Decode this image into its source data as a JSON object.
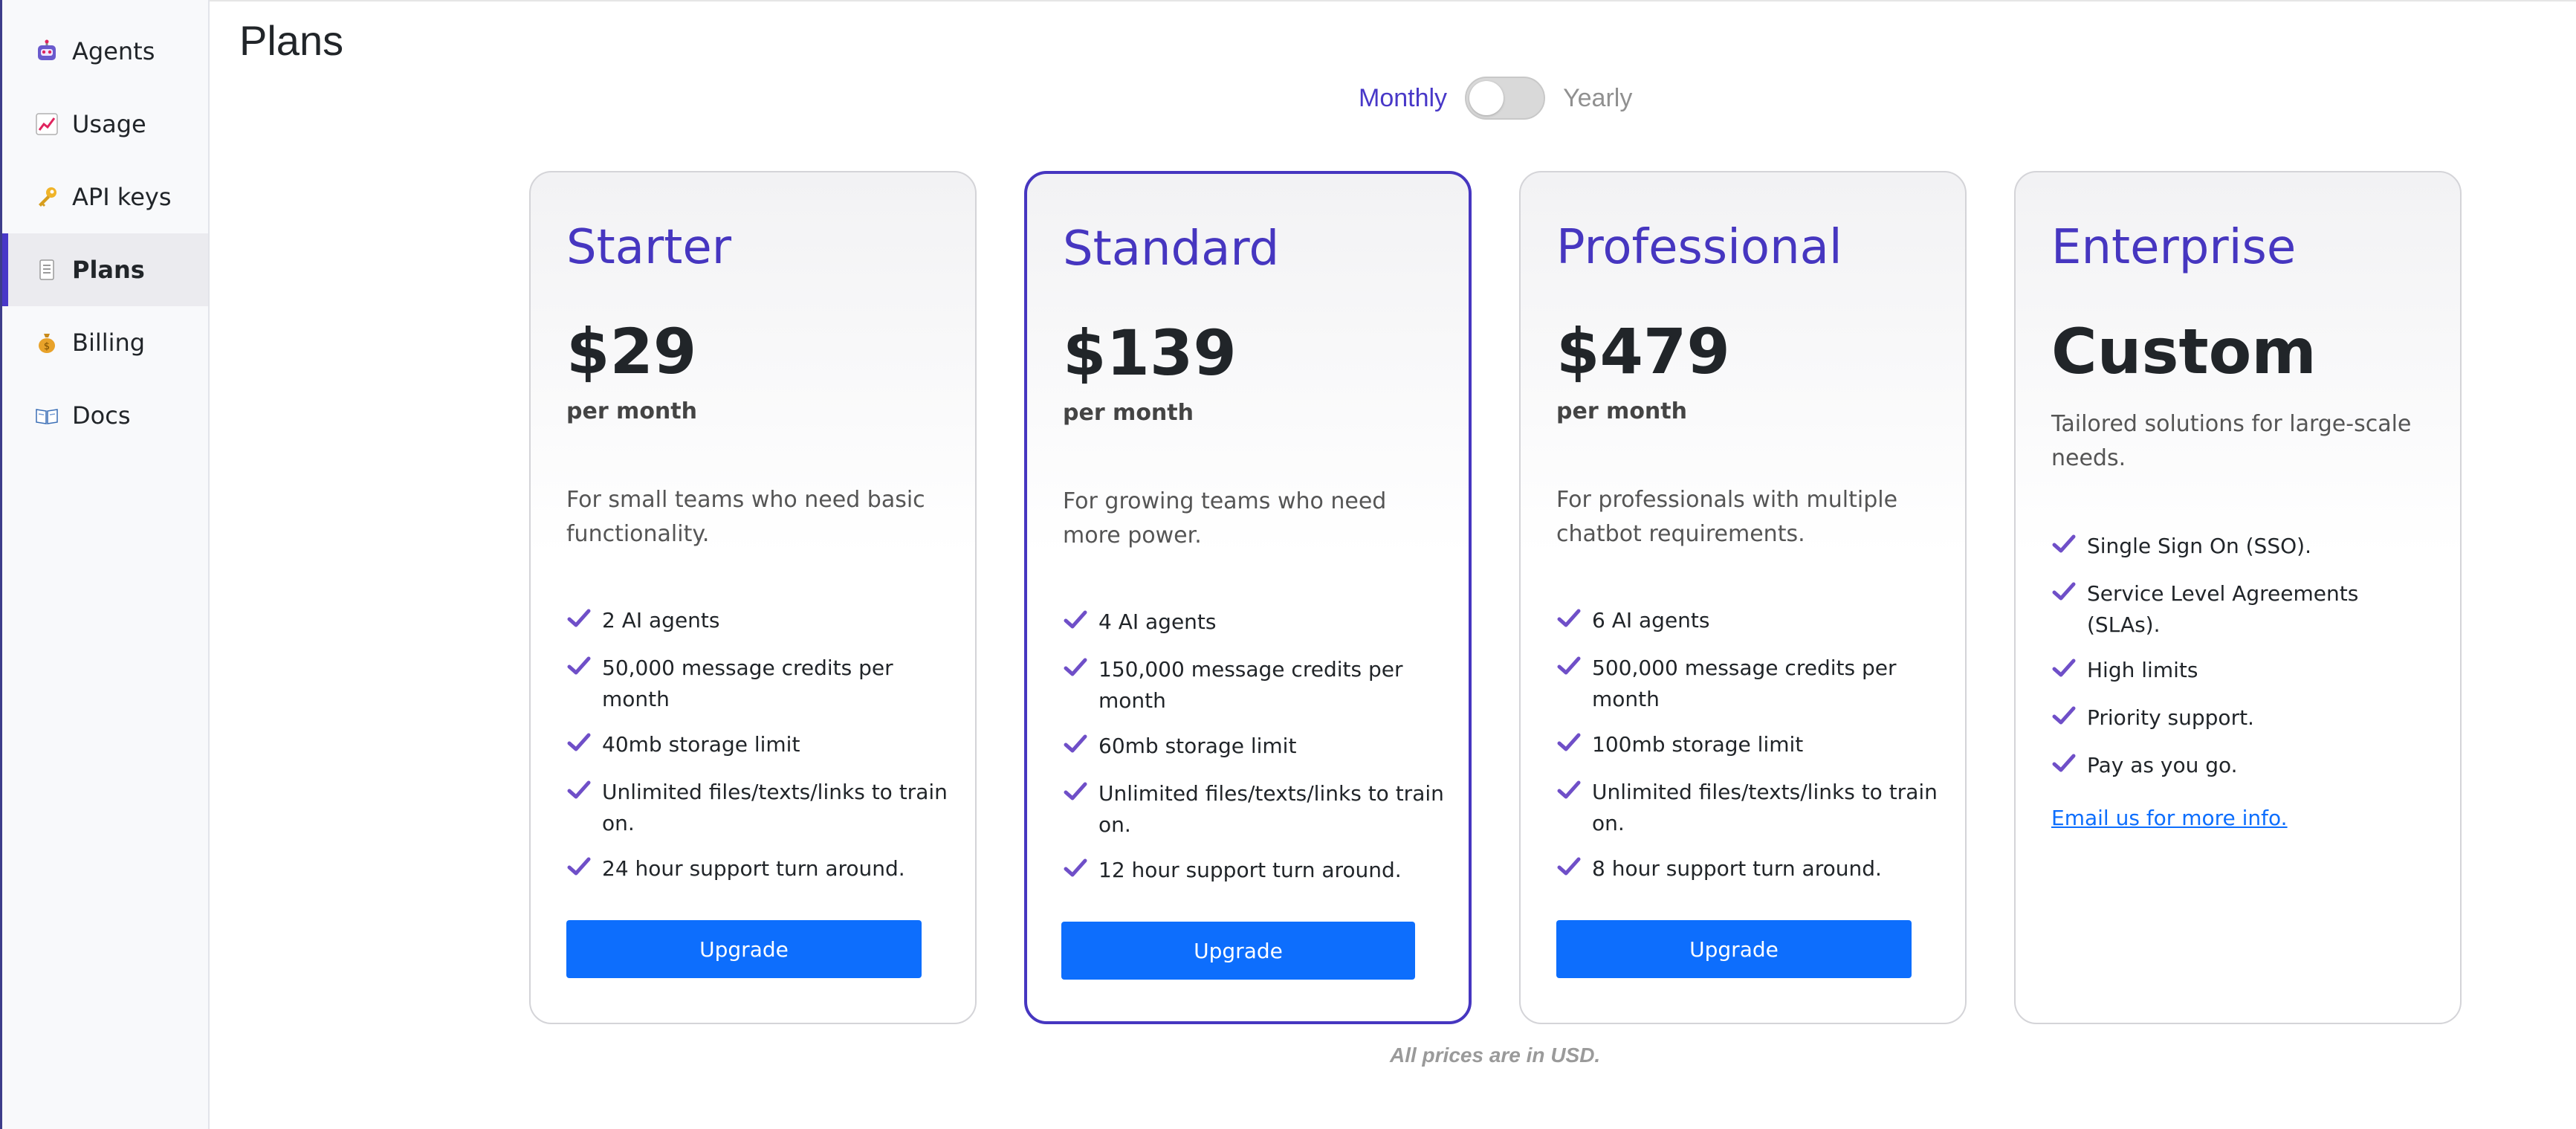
{
  "sidebar": {
    "items": [
      {
        "label": "Agents",
        "icon": "robot-icon"
      },
      {
        "label": "Usage",
        "icon": "chart-increasing-icon"
      },
      {
        "label": "API keys",
        "icon": "key-icon"
      },
      {
        "label": "Plans",
        "icon": "page-icon",
        "active": true
      },
      {
        "label": "Billing",
        "icon": "money-bag-icon"
      },
      {
        "label": "Docs",
        "icon": "open-book-icon"
      }
    ]
  },
  "page": {
    "title": "Plans"
  },
  "billing_toggle": {
    "monthly_label": "Monthly",
    "yearly_label": "Yearly",
    "selected": "Monthly"
  },
  "plans": [
    {
      "name": "Starter",
      "price": "$29",
      "period": "per month",
      "description": "For small teams who need basic functionality.",
      "features": [
        "2 AI agents",
        "50,000 message credits per month",
        "40mb storage limit",
        "Unlimited files/texts/links to train on.",
        "24 hour support turn around."
      ],
      "button_label": "Upgrade"
    },
    {
      "name": "Standard",
      "price": "$139",
      "period": "per month",
      "description": "For growing teams who need more power.",
      "features": [
        "4 AI agents",
        "150,000 message credits per month",
        "60mb storage limit",
        "Unlimited files/texts/links to train on.",
        "12 hour support turn around."
      ],
      "button_label": "Upgrade",
      "featured": true
    },
    {
      "name": "Professional",
      "price": "$479",
      "period": "per month",
      "description": "For professionals with multiple chatbot requirements.",
      "features": [
        "6 AI agents",
        "500,000 message credits per month",
        "100mb storage limit",
        "Unlimited files/texts/links to train on.",
        "8 hour support turn around."
      ],
      "button_label": "Upgrade"
    },
    {
      "name": "Enterprise",
      "price": "Custom",
      "description": "Tailored solutions for large-scale needs.",
      "features": [
        "Single Sign On (SSO).",
        "Service Level Agreements (SLAs).",
        "High limits",
        "Priority support.",
        "Pay as you go."
      ],
      "link_label": "Email us for more info."
    }
  ],
  "footnote": "All prices are in USD.",
  "colors": {
    "accent": "#4636c0",
    "button": "#0d6efd",
    "check": "#6f4fc8"
  }
}
